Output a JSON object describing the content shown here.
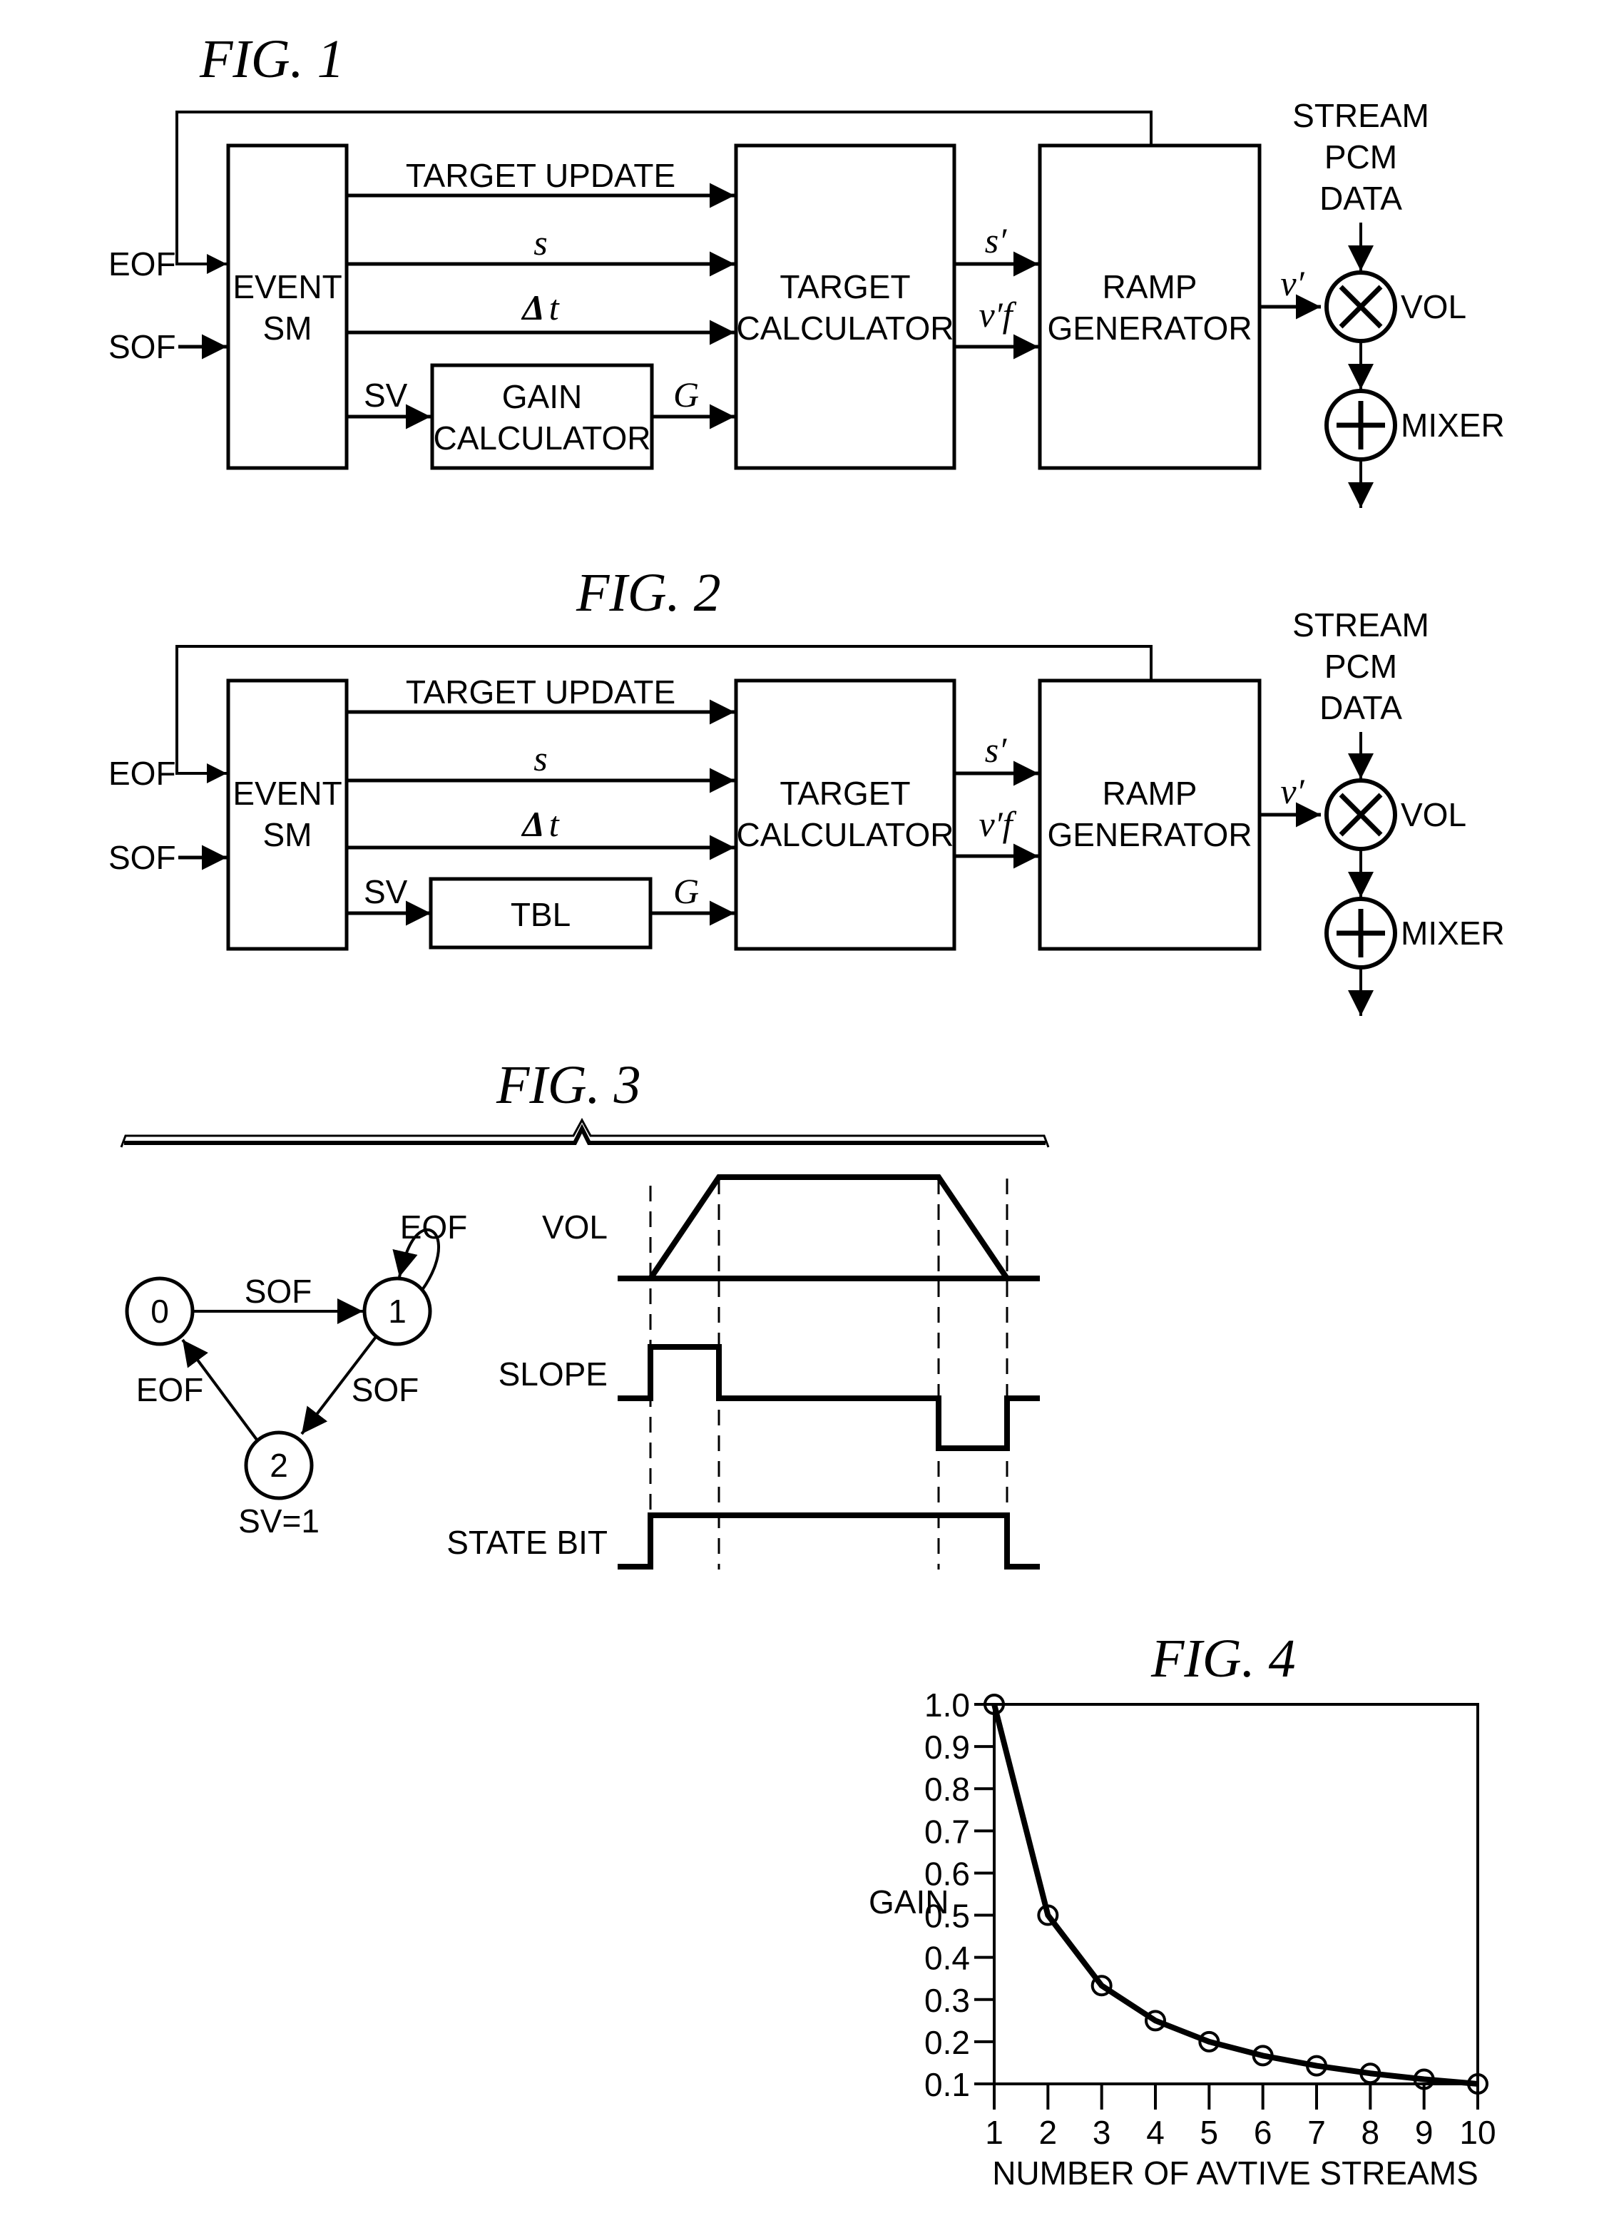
{
  "fig1": {
    "title": "FIG. 1",
    "inputs": [
      "EOF",
      "SOF"
    ],
    "blocks": {
      "event_sm": [
        "EVENT",
        "SM"
      ],
      "gain": [
        "GAIN",
        "CALCULATOR"
      ],
      "target": [
        "TARGET",
        "CALCULATOR"
      ],
      "ramp": [
        "RAMP",
        "GENERATOR"
      ]
    },
    "signals": {
      "target_update": "TARGET UPDATE",
      "s": "s",
      "dt_delta": "Δ",
      "dt_t": "t",
      "sv": "SV",
      "g": "G",
      "s_prime": "s′",
      "vf_prime": "v′f",
      "v_prime": "v′"
    },
    "stream": [
      "STREAM",
      "PCM",
      "DATA"
    ],
    "vol": "VOL",
    "mixer": "MIXER"
  },
  "fig2": {
    "title": "FIG. 2",
    "inputs": [
      "EOF",
      "SOF"
    ],
    "blocks": {
      "event_sm": [
        "EVENT",
        "SM"
      ],
      "tbl": "TBL",
      "target": [
        "TARGET",
        "CALCULATOR"
      ],
      "ramp": [
        "RAMP",
        "GENERATOR"
      ]
    },
    "signals": {
      "target_update": "TARGET UPDATE",
      "s": "s",
      "dt_delta": "Δ",
      "dt_t": "t",
      "sv": "SV",
      "g": "G",
      "s_prime": "s′",
      "vf_prime": "v′f",
      "v_prime": "v′"
    },
    "stream": [
      "STREAM",
      "PCM",
      "DATA"
    ],
    "vol": "VOL",
    "mixer": "MIXER"
  },
  "fig3": {
    "title": "FIG. 3",
    "states": [
      {
        "id": "0",
        "note": ""
      },
      {
        "id": "1",
        "note": ""
      },
      {
        "id": "2",
        "note": "SV=1"
      }
    ],
    "transitions": [
      {
        "from": "0",
        "to": "1",
        "label": "SOF"
      },
      {
        "from": "1",
        "to": "1",
        "label": "EOF"
      },
      {
        "from": "1",
        "to": "2",
        "label": "SOF"
      },
      {
        "from": "2",
        "to": "0",
        "label": "EOF"
      }
    ],
    "waveforms": [
      {
        "name": "VOL",
        "shape": "trapezoid"
      },
      {
        "name": "SLOPE",
        "shape": "positive pulse then negative pulse"
      },
      {
        "name": "STATE BIT",
        "shape": "high between first and last marker"
      }
    ]
  },
  "fig4": {
    "title": "FIG. 4"
  },
  "chart_data": {
    "type": "line",
    "title": "FIG. 4",
    "xlabel": "NUMBER OF AVTIVE STREAMS",
    "ylabel": "GAIN",
    "x": [
      1,
      2,
      3,
      4,
      5,
      6,
      7,
      8,
      9,
      10
    ],
    "series": [
      {
        "name": "GAIN",
        "values": [
          1.0,
          0.5,
          0.333,
          0.25,
          0.2,
          0.167,
          0.143,
          0.125,
          0.111,
          0.1
        ],
        "marker": "circle"
      }
    ],
    "xticks": [
      "1",
      "2",
      "3",
      "4",
      "5",
      "6",
      "7",
      "8",
      "9",
      "10"
    ],
    "yticks": [
      "0.1",
      "0.2",
      "0.3",
      "0.4",
      "0.5",
      "0.6",
      "0.7",
      "0.8",
      "0.9",
      "1.0"
    ],
    "xlim": [
      1,
      10
    ],
    "ylim": [
      0.1,
      1.0
    ],
    "grid": false,
    "legend": "none"
  }
}
